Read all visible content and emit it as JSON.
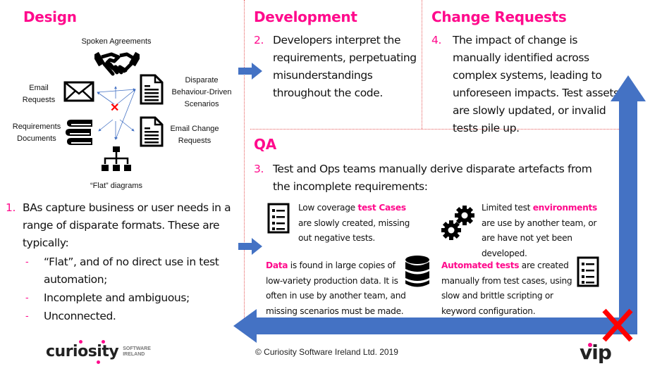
{
  "design": {
    "heading": "Design",
    "sources": {
      "spoken": "Spoken Agreements",
      "email_line1": "Email",
      "email_line2": "Requests",
      "bdd_line1": "Disparate",
      "bdd_line2": "Behaviour-Driven",
      "bdd_line3": "Scenarios",
      "reqdocs_line1": "Requirements",
      "reqdocs_line2": "Documents",
      "emailchange_line1": "Email Change",
      "emailchange_line2": "Requests",
      "flat": "“Flat” diagrams"
    },
    "step_number": "1.",
    "step_text": "BAs capture business or user needs in a range of disparate formats. These are typically:",
    "bullets": [
      "“Flat”, and of no direct use in test automation;",
      "Incomplete and ambiguous;",
      "Unconnected."
    ],
    "bullet_marker": "-"
  },
  "development": {
    "heading": "Development",
    "step_number": "2.",
    "step_text": "Developers interpret the requirements, perpetuating misunderstandings throughout the code."
  },
  "change_requests": {
    "heading": "Change Requests",
    "step_number": "4.",
    "step_text": "The impact of change is manually identified across complex systems, leading to unforeseen impacts. Test assets are slowly updated, or invalid tests pile up."
  },
  "qa": {
    "heading": "QA",
    "step_number": "3.",
    "step_text": "Test and Ops teams manually derive disparate artefacts from the incomplete requirements:",
    "test_cases": {
      "pre": "Low coverage ",
      "highlight": "test Cases",
      "post": " are slowly created, missing out negative tests."
    },
    "environments": {
      "pre": "Limited test ",
      "highlight": "environments",
      "post": " are use by another team, or are have not yet been developed."
    },
    "data": {
      "pre": "",
      "highlight": "Data",
      "post": " is found in large copies of low-variety production data. It is often in use by another team, and missing scenarios must be made."
    },
    "automated": {
      "pre": "",
      "highlight": "Automated tests",
      "post": " are created manually from test cases, using slow and brittle scripting or keyword configuration."
    }
  },
  "footer": {
    "copyright": "© Curiosity Software Ireland Ltd. 2019",
    "logo_main": "curiosity",
    "logo_sub1": "SOFTWARE",
    "logo_sub2": "IRELAND",
    "vip_logo": "vip"
  },
  "colors": {
    "accent_pink": "#ff0a8c",
    "arrow_blue": "#4472c4",
    "cross_red": "#ff0000",
    "divider_red": "#e65a5a"
  }
}
